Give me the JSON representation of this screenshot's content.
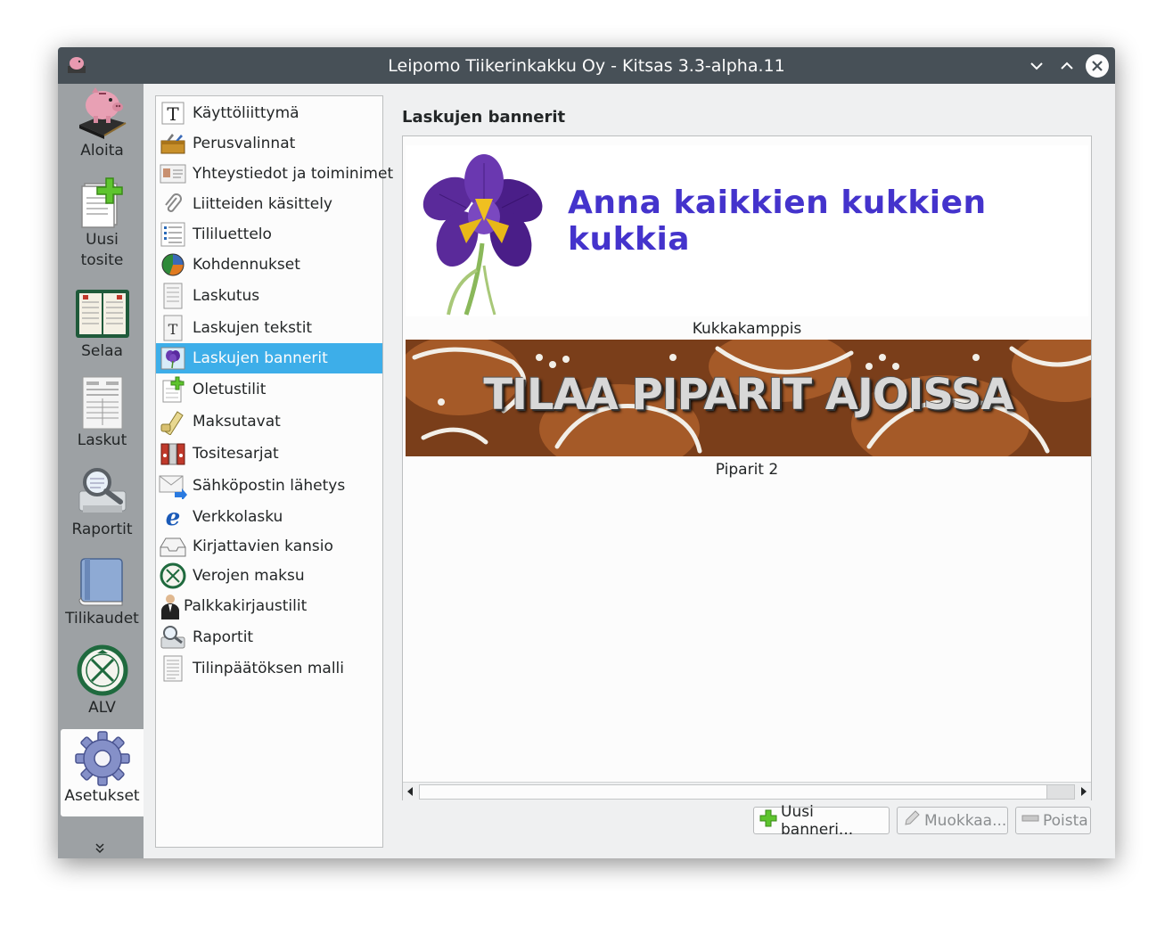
{
  "window": {
    "title": "Leipomo Tiikerinkakku Oy - Kitsas 3.3-alpha.11"
  },
  "sidebar": {
    "items": [
      {
        "label": "Aloita",
        "icon": "piggy-bank-icon"
      },
      {
        "label": "Uusi\ntosite",
        "icon": "new-document-icon"
      },
      {
        "label": "Selaa",
        "icon": "calendar-book-icon"
      },
      {
        "label": "Laskut",
        "icon": "invoice-icon"
      },
      {
        "label": "Raportit",
        "icon": "report-magnifier-icon"
      },
      {
        "label": "Tilikaudet",
        "icon": "book-icon"
      },
      {
        "label": "ALV",
        "icon": "tax-emblem-icon"
      },
      {
        "label": "Asetukset",
        "icon": "gear-icon",
        "active": true
      }
    ]
  },
  "settings_nav": {
    "items": [
      {
        "label": "Käyttöliittymä",
        "icon": "text-t-icon"
      },
      {
        "label": "Perusvalinnat",
        "icon": "toolbox-icon"
      },
      {
        "label": "Yhteystiedot ja toiminimet",
        "icon": "id-card-icon"
      },
      {
        "label": "Liitteiden käsittely",
        "icon": "paperclip-icon"
      },
      {
        "label": "Tililuettelo",
        "icon": "list-icon"
      },
      {
        "label": "Kohdennukset",
        "icon": "pie-chart-icon"
      },
      {
        "label": "Laskutus",
        "icon": "invoice-icon"
      },
      {
        "label": "Laskujen tekstit",
        "icon": "document-text-icon"
      },
      {
        "label": "Laskujen bannerit",
        "icon": "flower-icon",
        "selected": true
      },
      {
        "label": "Oletustilit",
        "icon": "document-add-icon"
      },
      {
        "label": "Maksutavat",
        "icon": "payment-card-icon"
      },
      {
        "label": "Tositesarjat",
        "icon": "binders-icon"
      },
      {
        "label": "Sähköpostin lähetys",
        "icon": "email-send-icon"
      },
      {
        "label": "Verkkolasku",
        "icon": "e-invoice-icon"
      },
      {
        "label": "Kirjattavien kansio",
        "icon": "inbox-tray-icon"
      },
      {
        "label": "Verojen maksu",
        "icon": "tax-emblem-icon"
      },
      {
        "label": "Palkkakirjaustilit",
        "icon": "person-suit-icon"
      },
      {
        "label": "Raportit",
        "icon": "report-magnifier-icon"
      },
      {
        "label": "Tilinpäätöksen malli",
        "icon": "document-lines-icon"
      }
    ]
  },
  "main": {
    "title": "Laskujen bannerit",
    "banners": [
      {
        "name": "Kukkakamppis",
        "image_text": "Anna kaikkien kukkien kukkia"
      },
      {
        "name": "Piparit 2",
        "image_text": "TILAA PIPARIT AJOISSA"
      }
    ],
    "buttons": {
      "new": "Uusi banneri...",
      "edit": "Muokkaa...",
      "delete": "Poista"
    }
  },
  "colors": {
    "titlebar": "#475057",
    "sidebar": "#9da1a4",
    "selection": "#3daee9",
    "banner_text": "#4433cc"
  }
}
